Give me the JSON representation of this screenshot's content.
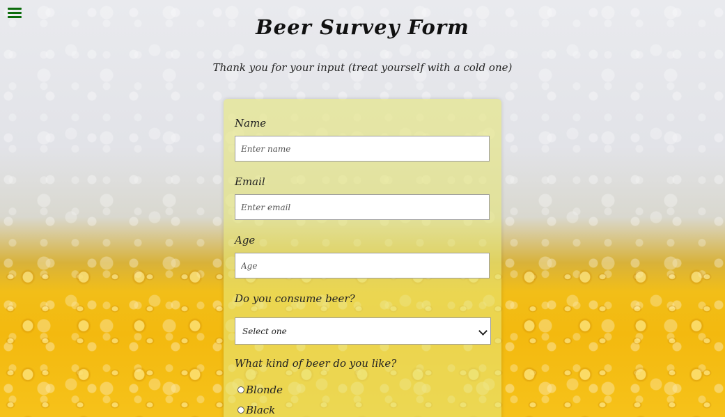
{
  "page": {
    "title": "Beer Survey Form",
    "description": "Thank you for your input (treat yourself with a cold one)"
  },
  "nav": {
    "menu_icon": "hamburger-menu-icon",
    "menu_color": "#0b6b0b"
  },
  "form": {
    "name": {
      "label": "Name",
      "placeholder": "Enter name",
      "value": ""
    },
    "email": {
      "label": "Email",
      "placeholder": "Enter email",
      "value": ""
    },
    "age": {
      "label": "Age",
      "placeholder": "Age",
      "value": ""
    },
    "consume": {
      "label": "Do you consume beer?",
      "selected": "Select one"
    },
    "kind": {
      "label": "What kind of beer do you like?",
      "options": [
        "Blonde",
        "Black"
      ]
    }
  },
  "colors": {
    "card_background": "#e6e678",
    "foam": "#e4e5ea",
    "beer": "#f3b90f"
  }
}
